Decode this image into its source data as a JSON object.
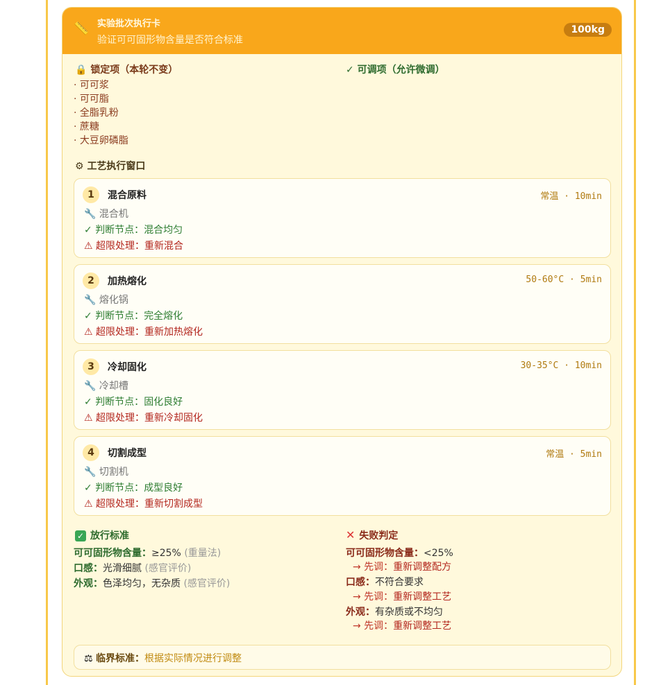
{
  "header": {
    "title": "实验批次执行卡",
    "subtitle": "验证可可固形物含量是否符合标准",
    "batch": "100kg",
    "icon": "ruler-icon"
  },
  "locked": {
    "title": "锁定项（本轮不变）",
    "items": [
      "· 可可浆",
      "· 可可脂",
      "· 全脂乳粉",
      "· 蔗糖",
      "· 大豆卵磷脂"
    ]
  },
  "adjustable": {
    "title": "✓ 可调项（允许微调）"
  },
  "process": {
    "title": "工艺执行窗口",
    "steps": [
      {
        "num": "1",
        "name": "混合原料",
        "cond": "常温 · 10min",
        "tool": "混合机",
        "check_label": "判断节点：",
        "check": "混合均匀",
        "over_label": "超限处理：",
        "over": "重新混合"
      },
      {
        "num": "2",
        "name": "加热熔化",
        "cond": "50-60°C · 5min",
        "tool": "熔化锅",
        "check_label": "判断节点：",
        "check": "完全熔化",
        "over_label": "超限处理：",
        "over": "重新加热熔化"
      },
      {
        "num": "3",
        "name": "冷却固化",
        "cond": "30-35°C · 10min",
        "tool": "冷却槽",
        "check_label": "判断节点：",
        "check": "固化良好",
        "over_label": "超限处理：",
        "over": "重新冷却固化"
      },
      {
        "num": "4",
        "name": "切割成型",
        "cond": "常温 · 5min",
        "tool": "切割机",
        "check_label": "判断节点：",
        "check": "成型良好",
        "over_label": "超限处理：",
        "over": "重新切割成型"
      }
    ]
  },
  "pass": {
    "title": "放行标准",
    "rows": [
      {
        "label": "可可固形物含量：",
        "value": "≥25%",
        "note": "(重量法)"
      },
      {
        "label": "口感：",
        "value": "光滑细腻",
        "note": "(感官评价)"
      },
      {
        "label": "外观：",
        "value": "色泽均匀，无杂质",
        "note": "(感官评价)"
      }
    ]
  },
  "fail": {
    "title": "失败判定",
    "rows": [
      {
        "label": "可可固形物含量：",
        "value": "<25%",
        "action_prefix": "→ 先调：",
        "action": "重新调整配方"
      },
      {
        "label": "口感：",
        "value": "不符合要求",
        "action_prefix": "→ 先调：",
        "action": "重新调整工艺"
      },
      {
        "label": "外观：",
        "value": "有杂质或不均匀",
        "action_prefix": "→ 先调：",
        "action": "重新调整工艺"
      }
    ]
  },
  "critical": {
    "label": "临界标准：",
    "value": "根据实际情况进行调整"
  }
}
